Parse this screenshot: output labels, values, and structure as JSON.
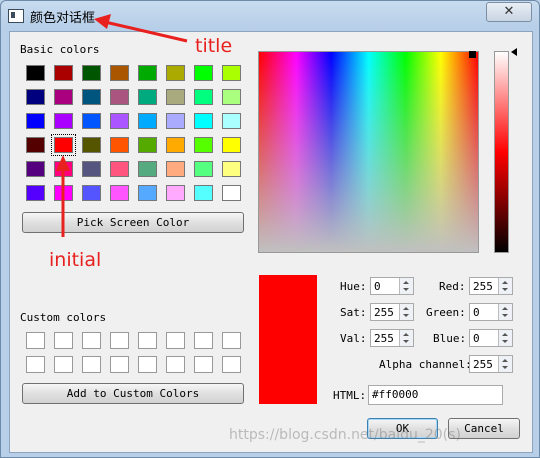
{
  "window": {
    "title": "颜色对话框",
    "close_label": "✕"
  },
  "basic_colors": {
    "label": "Basic colors",
    "rows": [
      [
        "#000000",
        "#aa0000",
        "#005500",
        "#aa5500",
        "#00aa00",
        "#aaaa00",
        "#00ff00",
        "#aaff00"
      ],
      [
        "#00007f",
        "#aa007f",
        "#00557f",
        "#aa557f",
        "#00aa7f",
        "#aaaa7f",
        "#00ff7f",
        "#aaff7f"
      ],
      [
        "#0000ff",
        "#aa00ff",
        "#0055ff",
        "#aa55ff",
        "#00aaff",
        "#aaaaff",
        "#00ffff",
        "#aaffff"
      ],
      [
        "#550000",
        "#ff0000",
        "#555500",
        "#ff5500",
        "#55aa00",
        "#ffaa00",
        "#55ff00",
        "#ffff00"
      ],
      [
        "#55007f",
        "#ff007f",
        "#55557f",
        "#ff557f",
        "#55aa7f",
        "#ffaa7f",
        "#55ff7f",
        "#ffff7f"
      ],
      [
        "#5500ff",
        "#ff00ff",
        "#5555ff",
        "#ff55ff",
        "#55aaff",
        "#ffaaff",
        "#55ffff",
        "#ffffff"
      ]
    ],
    "selected": "#ff0000"
  },
  "pick_screen_color_label": "Pick Screen Color",
  "custom_colors": {
    "label": "Custom colors",
    "rows": [
      [
        "#ffffff",
        "#ffffff",
        "#ffffff",
        "#ffffff",
        "#ffffff",
        "#ffffff",
        "#ffffff",
        "#ffffff"
      ],
      [
        "#ffffff",
        "#ffffff",
        "#ffffff",
        "#ffffff",
        "#ffffff",
        "#ffffff",
        "#ffffff",
        "#ffffff"
      ]
    ]
  },
  "add_custom_label": "Add to Custom Colors",
  "current_color": "#ff0000",
  "fields": {
    "hue": {
      "label": "Hue:",
      "value": "0"
    },
    "sat": {
      "label": "Sat:",
      "value": "255"
    },
    "val": {
      "label": "Val:",
      "value": "255"
    },
    "red": {
      "label": "Red:",
      "value": "255"
    },
    "green": {
      "label": "Green:",
      "value": "0"
    },
    "blue": {
      "label": "Blue:",
      "value": "0"
    },
    "alpha": {
      "label": "Alpha channel:",
      "value": "255"
    }
  },
  "html_field": {
    "label": "HTML:",
    "value": "#ff0000"
  },
  "buttons": {
    "ok": "OK",
    "cancel": "Cancel"
  },
  "annotations": {
    "title": "title",
    "initial": "initial",
    "color": "#e8201e"
  },
  "watermark": "https://blog.csdn.net/baidu_20(s)"
}
